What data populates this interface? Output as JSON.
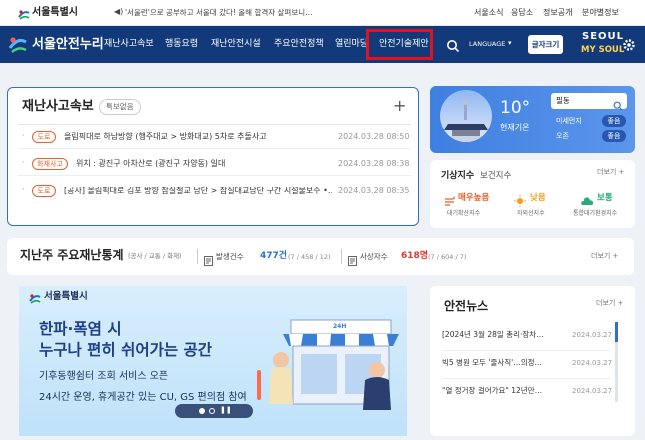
{
  "top_bar": {
    "logo_text": "서울특별시",
    "ticker": "'서울런'으로 공부하고 서울대 갔다! 올해 합격자 살펴보니…",
    "links": [
      "서울소식",
      "응답소",
      "정보공개",
      "분야별정보"
    ]
  },
  "gnb": {
    "logo_text": "서울안전누리",
    "menu": [
      "재난사고속보",
      "행동요령",
      "재난안전시설",
      "주요안전정책",
      "열린마당",
      "안전기술제안"
    ],
    "highlighted_menu": "안전기술제안",
    "language": "LANGUAGE",
    "font_size_button": "글자크기",
    "slogan_line1": "SEOUL",
    "slogan_line2": "MY SOUL"
  },
  "disaster_news": {
    "title": "재난사고속보",
    "badge": "특보없음",
    "items": [
      {
        "tag": "도로",
        "text": "올림픽대로 하남방향 (행주대교 > 방화대교) 5차로 추돌사고",
        "date": "2024.03.28 08:50"
      },
      {
        "tag": "화재사고",
        "text": "위치 : 광진구 아차산로 (광진구 자양동) 일대",
        "date": "2024.03.28 08:38"
      },
      {
        "tag": "도로",
        "text": "[공사] 올림픽대로 김포 방향 잠실철교 남단 > 잠실대교남단 구간 시설물보수 •…",
        "date": "2024.03.28 08:35"
      }
    ]
  },
  "weather": {
    "temperature": "10°",
    "condition": "현재기온",
    "district": "필동",
    "dust": [
      {
        "label": "미세먼지",
        "value": "좋음"
      },
      {
        "label": "오존",
        "value": "좋음"
      }
    ]
  },
  "weather_index": {
    "title": "기상지수",
    "subtitle": "보건지수",
    "more": "더보기 +",
    "items": [
      {
        "value": "매우높음",
        "label": "대기확산지수",
        "color": "#e8602c"
      },
      {
        "value": "낮음",
        "label": "자외선지수",
        "color": "#f0a020"
      },
      {
        "value": "보통",
        "label": "통합대기환경지수",
        "color": "#2aa876"
      }
    ]
  },
  "weekly_stats": {
    "title": "지난주 주요재난통계",
    "subtitle": "(공사 / 교통 / 화재)",
    "occurrence_label": "발생건수",
    "occurrence_value": "477건",
    "occurrence_detail": "(7 / 458 / 12)",
    "casualty_label": "사상자수",
    "casualty_value": "618명",
    "casualty_detail": "(7 / 604 / 7)",
    "more": "더보기 +"
  },
  "banner": {
    "logo_text": "서울특별시",
    "headline1": "한파·폭염 시",
    "headline2": "누구나 편히 쉬어가는 공간",
    "line1": "기후동행쉼터 조회 서비스 오픈",
    "line2": "24시간 운영, 휴게공간 있는 CU, GS 편의점 참여",
    "store_sign": "24H"
  },
  "safety_news": {
    "title": "안전뉴스",
    "more": "더보기 +",
    "items": [
      {
        "text": "[2024년 3월 28일 총리·장차…",
        "date": "2024.03.27"
      },
      {
        "text": "빅5 병원 모두 '줄사직'…의정…",
        "date": "2024.03.27"
      },
      {
        "text": "\"열 정거장 걸어가요\" 12년만…",
        "date": "2024.03.27"
      }
    ]
  },
  "colors": {
    "navy": "#123a7a",
    "highlight_border": "#e0141e",
    "tag_orange": "#e8602c",
    "stat_blue": "#2b6fd6",
    "stat_red": "#e03a2f"
  }
}
